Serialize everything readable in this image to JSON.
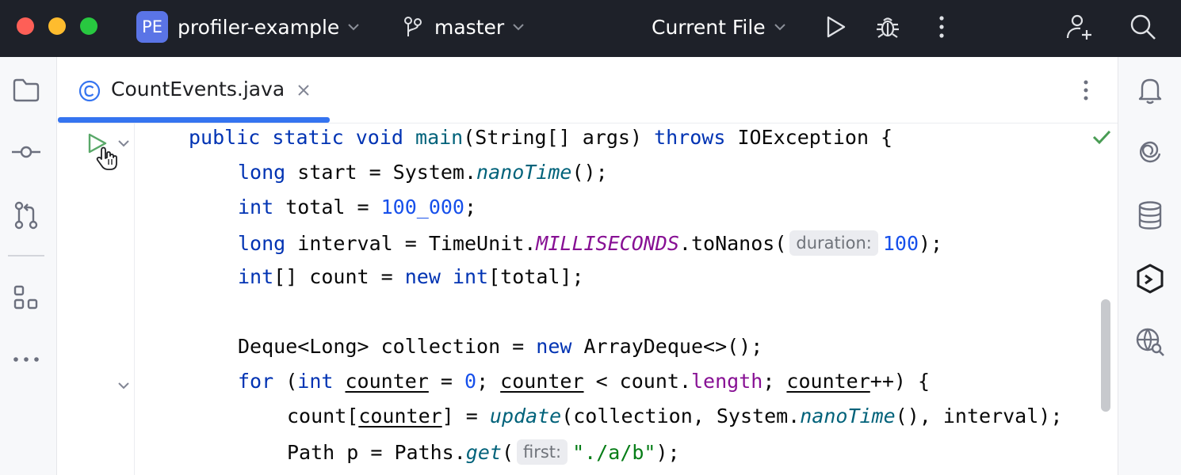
{
  "titlebar": {
    "project_badge": "PE",
    "project_name": "profiler-example",
    "branch": "master",
    "run_configuration": "Current File",
    "icons": [
      "chevron-down-icon",
      "branch-icon",
      "run-icon",
      "debug-icon",
      "more-vertical-icon",
      "add-user-icon",
      "search-icon"
    ]
  },
  "left_toolbar": {
    "icons": [
      "folder-icon",
      "commit-icon",
      "pull-request-icon",
      "structure-icon",
      "more-horizontal-icon"
    ]
  },
  "right_toolbar": {
    "icons": [
      "notifications-bell-icon",
      "ai-assistant-icon",
      "database-icon",
      "gradle-icon",
      "endpoints-globe-icon"
    ]
  },
  "tabs": [
    {
      "label": "CountEvents.java",
      "icon": "class-icon",
      "active": true
    }
  ],
  "editor": {
    "lines": [
      {
        "indent": 1,
        "tokens": [
          {
            "t": "public",
            "c": "kw"
          },
          {
            "t": " "
          },
          {
            "t": "static",
            "c": "kw"
          },
          {
            "t": " "
          },
          {
            "t": "void",
            "c": "kw"
          },
          {
            "t": " "
          },
          {
            "t": "main",
            "c": "fn"
          },
          {
            "t": "(String[] args) "
          },
          {
            "t": "throws",
            "c": "kw"
          },
          {
            "t": " IOException {"
          }
        ]
      },
      {
        "indent": 2,
        "tokens": [
          {
            "t": "long",
            "c": "kw"
          },
          {
            "t": " start = System."
          },
          {
            "t": "nanoTime",
            "c": "static-fn"
          },
          {
            "t": "();"
          }
        ]
      },
      {
        "indent": 2,
        "tokens": [
          {
            "t": "int",
            "c": "kw"
          },
          {
            "t": " total = "
          },
          {
            "t": "100_000",
            "c": "num"
          },
          {
            "t": ";"
          }
        ]
      },
      {
        "indent": 2,
        "tokens": [
          {
            "t": "long",
            "c": "kw"
          },
          {
            "t": " interval = TimeUnit."
          },
          {
            "t": "MILLISECONDS",
            "c": "const"
          },
          {
            "t": ".toNanos("
          },
          {
            "t": "duration:",
            "c": "hint"
          },
          {
            "t": "100",
            "c": "num"
          },
          {
            "t": ");"
          }
        ]
      },
      {
        "indent": 2,
        "tokens": [
          {
            "t": "int",
            "c": "kw"
          },
          {
            "t": "[] count = "
          },
          {
            "t": "new",
            "c": "kw"
          },
          {
            "t": " "
          },
          {
            "t": "int",
            "c": "kw"
          },
          {
            "t": "[total];"
          }
        ]
      },
      {
        "indent": 0,
        "tokens": []
      },
      {
        "indent": 2,
        "tokens": [
          {
            "t": "Deque<Long> collection = "
          },
          {
            "t": "new",
            "c": "kw"
          },
          {
            "t": " ArrayDeque<>();"
          }
        ]
      },
      {
        "indent": 2,
        "tokens": [
          {
            "t": "for",
            "c": "kw"
          },
          {
            "t": " ("
          },
          {
            "t": "int",
            "c": "kw"
          },
          {
            "t": " "
          },
          {
            "t": "counter",
            "c": "ul"
          },
          {
            "t": " = "
          },
          {
            "t": "0",
            "c": "num"
          },
          {
            "t": "; "
          },
          {
            "t": "counter",
            "c": "ul"
          },
          {
            "t": " < count."
          },
          {
            "t": "length",
            "c": "field"
          },
          {
            "t": "; "
          },
          {
            "t": "counter",
            "c": "ul"
          },
          {
            "t": "++) {"
          }
        ]
      },
      {
        "indent": 3,
        "tokens": [
          {
            "t": "count["
          },
          {
            "t": "counter",
            "c": "ul"
          },
          {
            "t": "] = "
          },
          {
            "t": "update",
            "c": "static-fn"
          },
          {
            "t": "(collection, System."
          },
          {
            "t": "nanoTime",
            "c": "static-fn"
          },
          {
            "t": "(), interval);"
          }
        ]
      },
      {
        "indent": 3,
        "tokens": [
          {
            "t": "Path p = Paths."
          },
          {
            "t": "get",
            "c": "static-fn"
          },
          {
            "t": "("
          },
          {
            "t": "first:",
            "c": "hint"
          },
          {
            "t": "\"./a/b\"",
            "c": "str"
          },
          {
            "t": ");"
          }
        ]
      }
    ]
  },
  "colors": {
    "titlebar_bg": "#1e2129",
    "accent": "#3574f0",
    "keyword": "#0033b3",
    "number": "#1750eb",
    "string": "#067d17",
    "method": "#00627a",
    "constant": "#871094",
    "run_gutter": "#59a869"
  }
}
